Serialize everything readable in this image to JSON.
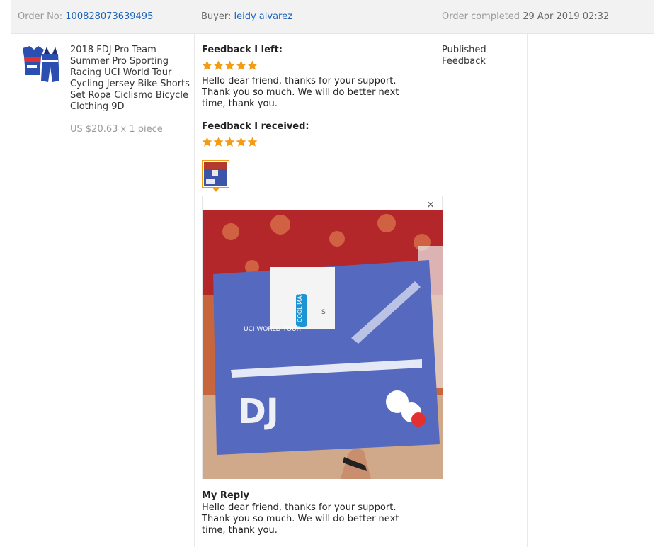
{
  "header": {
    "order_label": "Order No:",
    "order_number": "100828073639495",
    "buyer_label": "Buyer:",
    "buyer_name": "leidy alvarez",
    "completed_label": "Order completed",
    "completed_date": "29 Apr 2019 02:32"
  },
  "product": {
    "name": "2018 FDJ Pro Team Summer Pro Sporting Racing UCI World Tour Cycling Jersey Bike Shorts Set Ropa Ciclismo Bicycle Clothing 9D",
    "price": "US $20.63 x 1 piece"
  },
  "feedback_left": {
    "title": "Feedback I left:",
    "rating": 5,
    "text": "Hello dear friend, thanks for your support. Thank you so much. We will do better next time, thank you."
  },
  "feedback_received": {
    "title": "Feedback I received:",
    "rating": 5
  },
  "status": {
    "line1": "Published",
    "line2": "Feedback"
  },
  "viewer": {
    "close_glyph": "×",
    "tag_brand": "COOL MAX",
    "tag_size": "S",
    "jersey_text": "UCI WORLD TOUR",
    "jersey_letters": "DJ"
  },
  "reply": {
    "title": "My Reply",
    "text": "Hello dear friend, thanks for your support. Thank you so much. We will do better next time, thank you."
  },
  "colors": {
    "link": "#1a61b8",
    "star": "#f39c12",
    "header_bg": "#f2f2f2"
  }
}
